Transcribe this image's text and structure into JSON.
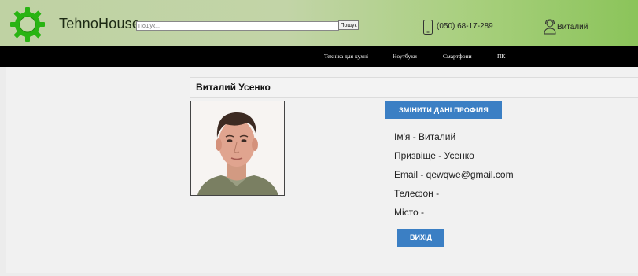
{
  "header": {
    "brand": "TehnoHouse",
    "search_placeholder": "Пошук...",
    "search_button": "Пошук",
    "phone": "(050) 68-17-289",
    "user_name": "Виталий"
  },
  "nav": {
    "items": [
      "Техніка для кухні",
      "Ноутбуки",
      "Смартфони",
      "ПК"
    ]
  },
  "profile": {
    "full_name": "Виталий Усенко",
    "edit_button": "ЗМІНИТИ ДАНІ ПРОФІЛЯ",
    "first_name": "Ім'я - Виталий",
    "last_name": "Призвіще - Усенко",
    "email": "Email - qewqwe@gmail.com",
    "phone": "Телефон -",
    "city": "Місто -",
    "logout_button": "ВИХІД"
  },
  "colors": {
    "accent": "#3b7fc4",
    "nav_bg": "#000000",
    "logo_green": "#29b413"
  }
}
